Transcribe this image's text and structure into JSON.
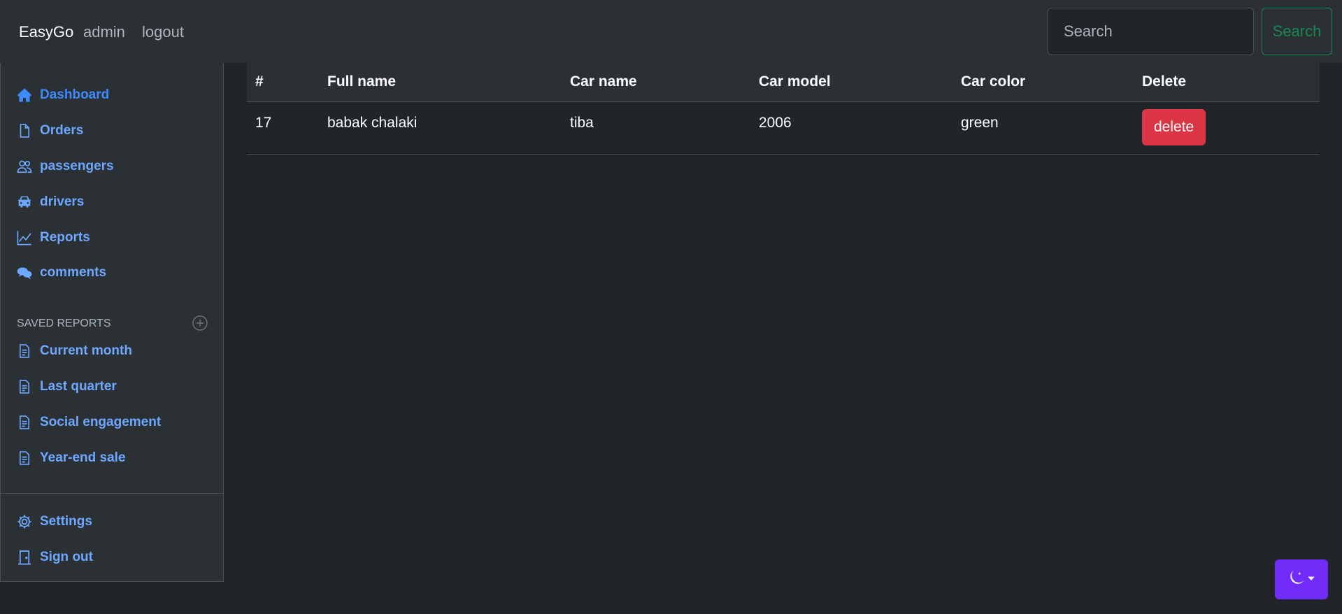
{
  "header": {
    "brand": "EasyGo",
    "admin_link": "admin",
    "logout_link": "logout",
    "search_placeholder": "Search",
    "search_button": "Search"
  },
  "sidebar": {
    "items": [
      {
        "label": "Dashboard",
        "icon": "house-icon"
      },
      {
        "label": "Orders",
        "icon": "file-icon"
      },
      {
        "label": "passengers",
        "icon": "people-icon"
      },
      {
        "label": "drivers",
        "icon": "car-icon"
      },
      {
        "label": "Reports",
        "icon": "graph-icon"
      },
      {
        "label": "comments",
        "icon": "chat-icon"
      }
    ],
    "saved_reports_heading": "Saved reports",
    "saved_reports": [
      {
        "label": "Current month",
        "icon": "file-text-icon"
      },
      {
        "label": "Last quarter",
        "icon": "file-text-icon"
      },
      {
        "label": "Social engagement",
        "icon": "file-text-icon"
      },
      {
        "label": "Year-end sale",
        "icon": "file-text-icon"
      }
    ],
    "settings": "Settings",
    "sign_out": "Sign out"
  },
  "table": {
    "headers": [
      "#",
      "Full name",
      "Car name",
      "Car model",
      "Car color",
      "Delete"
    ],
    "rows": [
      {
        "id": "17",
        "full_name": "babak chalaki",
        "car_name": "tiba",
        "car_model": "2006",
        "car_color": "green",
        "delete_label": "delete"
      }
    ]
  },
  "colors": {
    "accent": "#6ea8fe",
    "danger": "#dc3545",
    "success": "#198754",
    "theme_toggle": "#712cf9"
  }
}
